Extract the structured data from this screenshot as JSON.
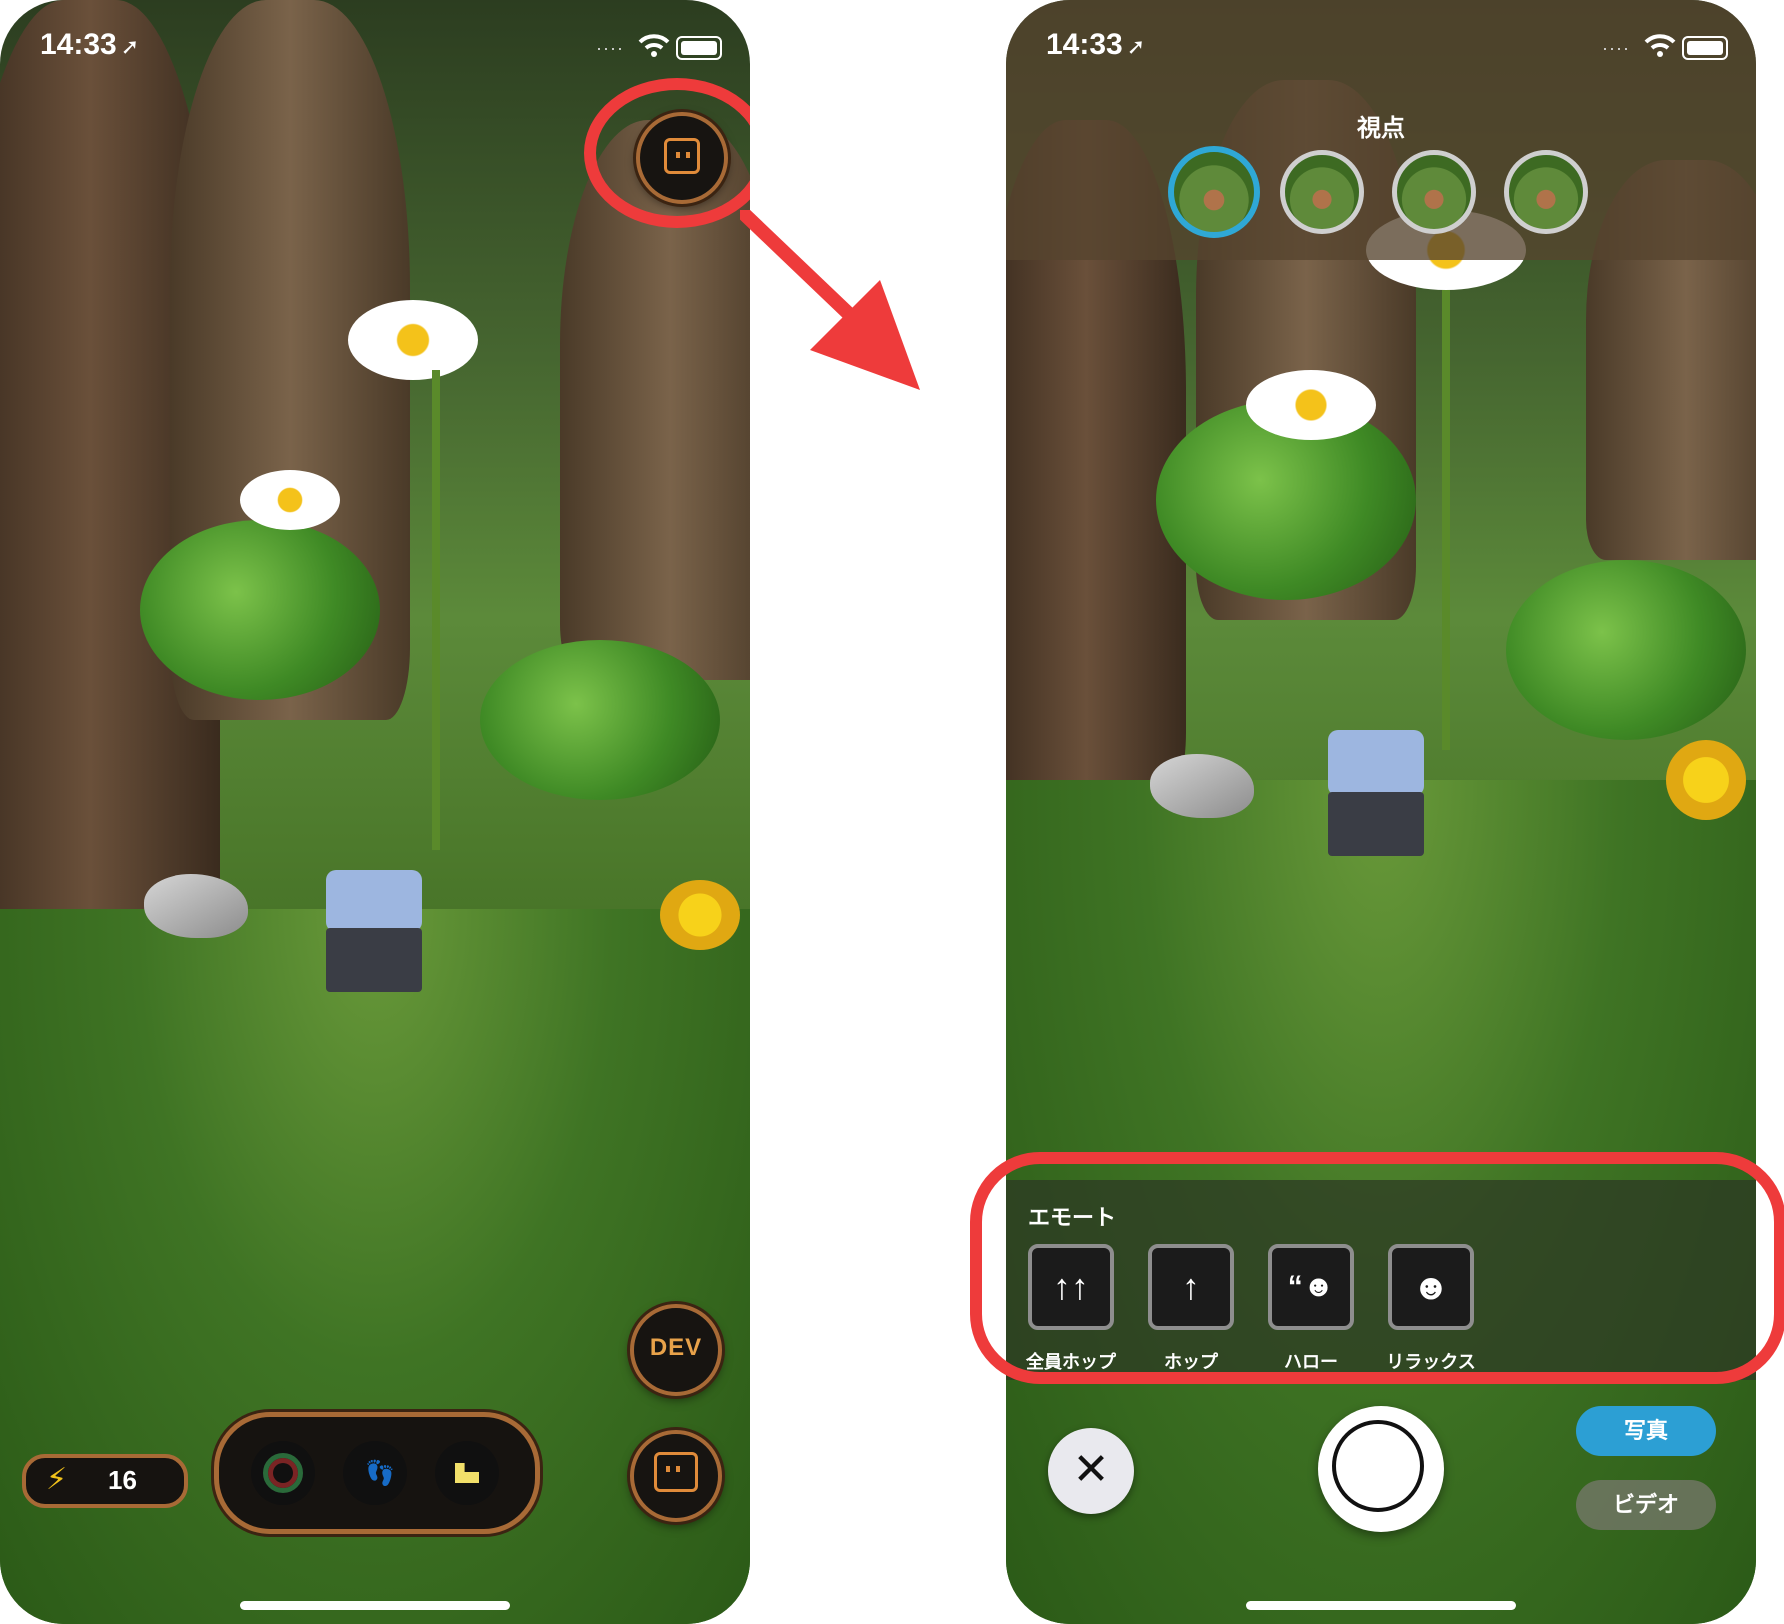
{
  "status_bar": {
    "time": "14:33",
    "location_glyph": "➚",
    "signal_glyph": "····"
  },
  "left_screen": {
    "dev_label": "DEV",
    "energy_value": "16",
    "bolt_glyph": "⚡",
    "steps_glyph": "👣"
  },
  "right_screen": {
    "viewpoint_label": "視点",
    "emote_title": "エモート",
    "emotes": [
      {
        "label": "全員ホップ",
        "glyph": "↑↑"
      },
      {
        "label": "ホップ",
        "glyph": "↑"
      },
      {
        "label": "ハロー",
        "glyph": "“☻"
      },
      {
        "label": "リラックス",
        "glyph": "☻"
      }
    ],
    "close_glyph": "✕",
    "photo_label": "写真",
    "video_label": "ビデオ"
  },
  "colors": {
    "callout_red": "#ee3b3b",
    "accent_blue": "#2c9fd4",
    "frame_copper": "#a86a36",
    "icon_orange": "#e08b3a"
  }
}
